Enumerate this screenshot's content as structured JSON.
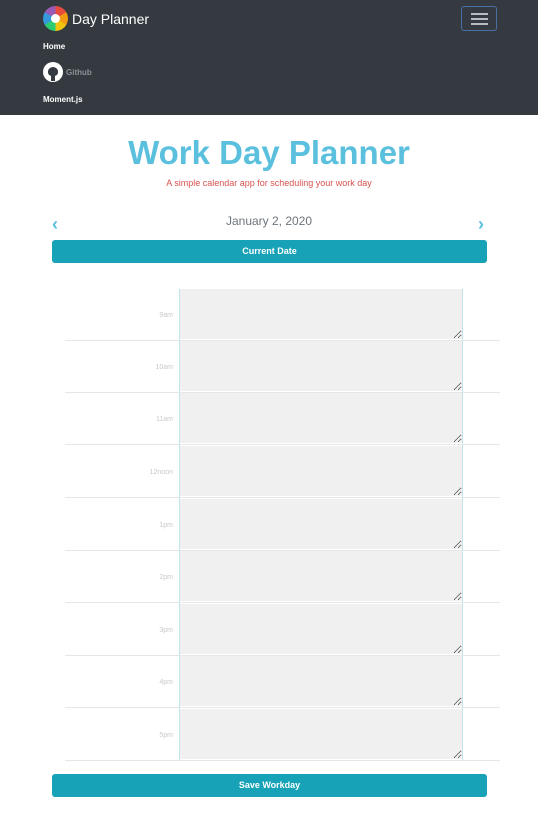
{
  "navbar": {
    "brand": "Day Planner",
    "links": [
      {
        "label": "Home"
      },
      {
        "label": "Github"
      },
      {
        "label": "Moment.js"
      }
    ]
  },
  "header": {
    "title": "Work Day Planner",
    "subtitle": "A simple calendar app for scheduling your work day"
  },
  "date_nav": {
    "prev_icon": "chevron-left-icon",
    "next_icon": "chevron-right-icon",
    "date": "January 2, 2020",
    "current_button": "Current Date"
  },
  "planner": {
    "hours": [
      {
        "label": "9am",
        "value": ""
      },
      {
        "label": "10am",
        "value": ""
      },
      {
        "label": "11am",
        "value": ""
      },
      {
        "label": "12noon",
        "value": ""
      },
      {
        "label": "1pm",
        "value": ""
      },
      {
        "label": "2pm",
        "value": ""
      },
      {
        "label": "3pm",
        "value": ""
      },
      {
        "label": "4pm",
        "value": ""
      },
      {
        "label": "5pm",
        "value": ""
      }
    ]
  },
  "save_button": "Save Workday",
  "colors": {
    "navbar": "#343a40",
    "accent": "#5bc0de",
    "button": "#17a2b8",
    "subtitle": "#d9534f"
  }
}
